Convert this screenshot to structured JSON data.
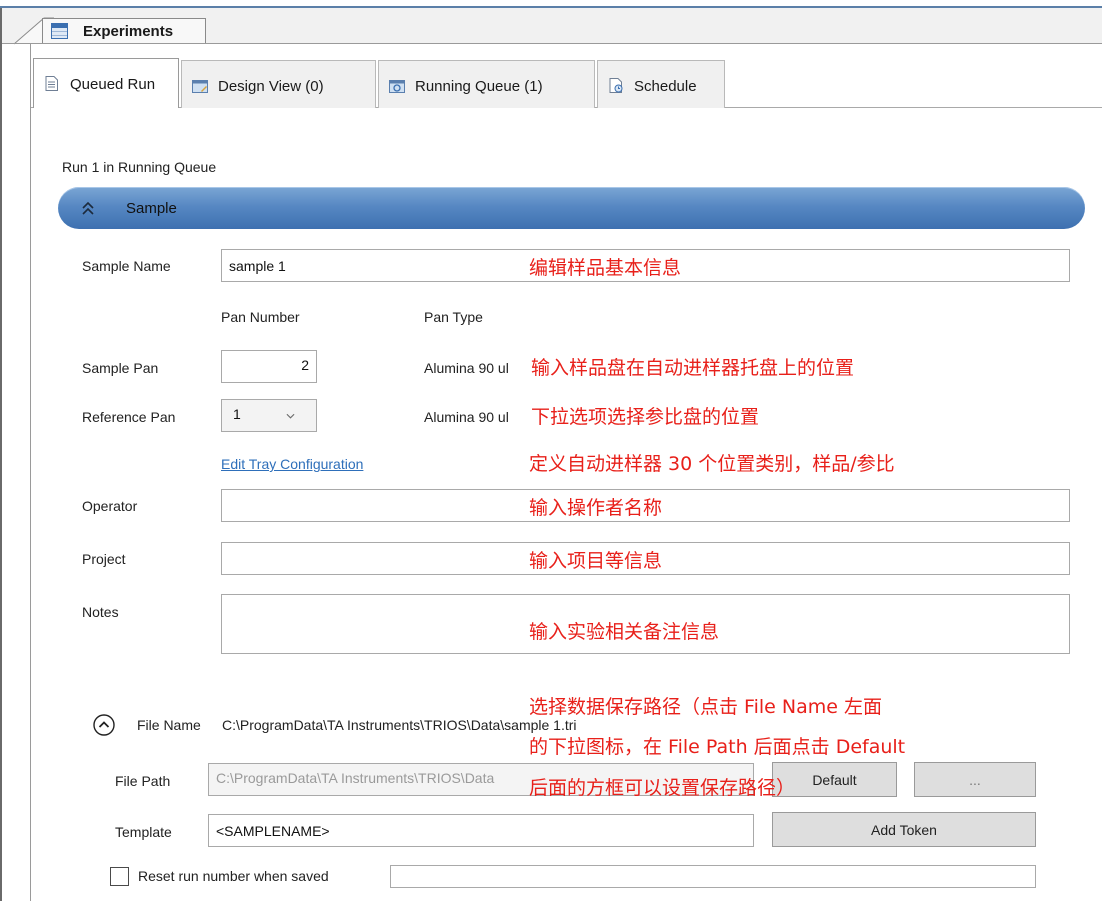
{
  "document_tab": {
    "label": "Experiments"
  },
  "tabs": [
    {
      "label": "Queued Run",
      "icon": "document-icon",
      "active": true
    },
    {
      "label": "Design View (0)",
      "icon": "design-view-icon",
      "active": false
    },
    {
      "label": "Running Queue (1)",
      "icon": "running-queue-icon",
      "active": false
    },
    {
      "label": "Schedule",
      "icon": "schedule-icon",
      "active": false
    }
  ],
  "run_info": "Run 1 in Running Queue",
  "sample_section": {
    "title": "Sample",
    "icon": "double-chevron-up-icon"
  },
  "form": {
    "sample_name": {
      "label": "Sample Name",
      "value": "sample 1"
    },
    "pan_number_header": "Pan Number",
    "pan_type_header": "Pan Type",
    "sample_pan": {
      "label": "Sample Pan",
      "value": "2",
      "type": "Alumina 90 ul"
    },
    "reference_pan": {
      "label": "Reference Pan",
      "value": "1",
      "type": "Alumina 90 ul"
    },
    "edit_tray_link": "Edit Tray Configuration",
    "operator": {
      "label": "Operator",
      "value": ""
    },
    "project": {
      "label": "Project",
      "value": ""
    },
    "notes": {
      "label": "Notes",
      "value": ""
    }
  },
  "file_section": {
    "label": "File Name",
    "path_display": "C:\\ProgramData\\TA Instruments\\TRIOS\\Data\\sample 1.tri",
    "file_path": {
      "label": "File Path",
      "value": "C:\\ProgramData\\TA Instruments\\TRIOS\\Data"
    },
    "default_button": "Default",
    "browse_button": "...",
    "template": {
      "label": "Template",
      "value": "<SAMPLENAME>"
    },
    "add_token_button": "Add Token",
    "reset_checkbox": {
      "label": "Reset run number when saved",
      "checked": false
    }
  },
  "annotations": {
    "sample_name": "编辑样品基本信息",
    "sample_pan": "输入样品盘在自动进样器托盘上的位置",
    "reference_pan": "下拉选项选择参比盘的位置",
    "tray": "定义自动进样器 30 个位置类别，样品/参比",
    "operator": "输入操作者名称",
    "project": "输入项目等信息",
    "notes": "输入实验相关备注信息",
    "file_line1": "选择数据保存路径（点击 File Name 左面",
    "file_line2": "的下拉图标，在 File Path 后面点击 Default",
    "file_line3": "后面的方框可以设置保存路径）"
  },
  "colors": {
    "accent_bar": "#4a7fbd",
    "annotation_red": "#e8201a",
    "link_blue": "#2e6fba"
  }
}
